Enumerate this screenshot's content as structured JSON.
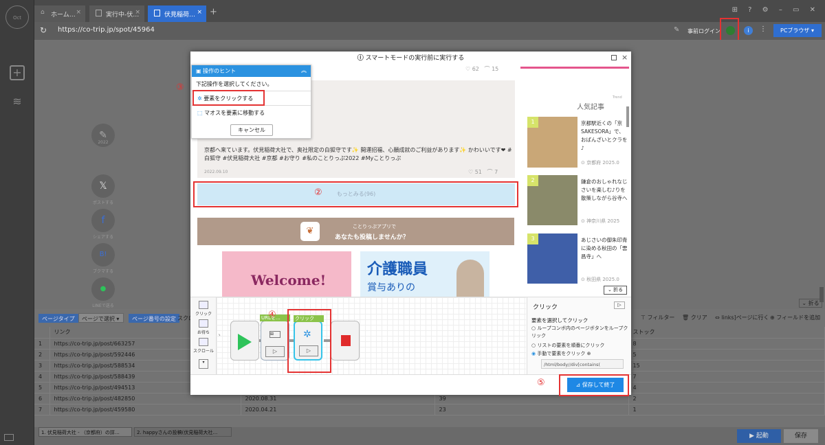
{
  "tabs": [
    {
      "label": "ホーム…"
    },
    {
      "label": "実行中-伏…"
    },
    {
      "label": "伏見稲荷…"
    }
  ],
  "url": "https://co-trip.jp/spot/45964",
  "toolbar": {
    "login": "事前ログイン",
    "browser": "PCブラウザ"
  },
  "page_actions": {
    "page_type": "ページタイプ",
    "page_select": "ページで選択",
    "page_number": "ページ番号の設定",
    "scroll": "スクロ",
    "filter": "フィルター",
    "clear": "クリア",
    "link_page": "links]ページに行く",
    "add_field": "フィールドを追加"
  },
  "table": {
    "col_link": "リンク",
    "col_stock": "ストック",
    "rows": [
      {
        "num": "1",
        "link": "https://co-trip.jp/post/663257",
        "date": "",
        "count": "",
        "stock": "8"
      },
      {
        "num": "2",
        "link": "https://co-trip.jp/post/592446",
        "date": "",
        "count": "",
        "stock": "5"
      },
      {
        "num": "3",
        "link": "https://co-trip.jp/post/588534",
        "date": "",
        "count": "",
        "stock": "15"
      },
      {
        "num": "4",
        "link": "https://co-trip.jp/post/588439",
        "date": "",
        "count": "",
        "stock": "7"
      },
      {
        "num": "5",
        "link": "https://co-trip.jp/post/494513",
        "date": "",
        "count": "",
        "stock": "4"
      },
      {
        "num": "6",
        "link": "https://co-trip.jp/post/482850",
        "date": "2020.08.31",
        "count": "39",
        "stock": "2"
      },
      {
        "num": "7",
        "link": "https://co-trip.jp/post/459580",
        "date": "2020.04.21",
        "count": "23",
        "stock": "1"
      }
    ]
  },
  "footer": {
    "tab1": "1. 伏見稲荷大社 - （京都府）の詳…",
    "tab2": "2. happyさんの投稿(伏見稲荷大社…",
    "run": "起動",
    "save": "保存"
  },
  "collapse": "折る",
  "modal": {
    "title": "スマートモードの実行前に実行する",
    "top_likes": "62",
    "top_clips": "15",
    "post_text": "京都へ来ています。伏見稲荷大社で、奥社限定の白狐守です✨ 開運招福、心願成就のご利益があります✨ かわいいです❤ #白狐守 #伏見稲荷大社 #京都 #お守り #私のことりっぷ2022 #Myことりっぷ",
    "post_date": "2022.09.10",
    "post_likes": "51",
    "post_clips": "7",
    "more_button": "もっとみる(96)",
    "app_banner_sub": "ことりっぷアプリで",
    "app_banner_main": "あなたも投稿しませんか？",
    "ad1": "Welcome!",
    "ad2": "介護職員",
    "ad2_sub": "賞与ありの",
    "popular_title": "人気記事",
    "trend": "Trend",
    "articles": [
      {
        "rank": "1",
        "text": "京都駅近くの「京SAKESORA」で、おばんざいとクラを♪",
        "pref": "京都府",
        "date": "2025.0"
      },
      {
        "rank": "2",
        "text": "鎌倉のおしゃれなじさいを楽しむ♪りを散策しながら谷寺へ",
        "pref": "神奈川県",
        "date": "2025"
      },
      {
        "rank": "3",
        "text": "あじさいの御朱印青に染める秋田の「雲昌寺」へ",
        "pref": "秋田県",
        "date": "2025.0"
      }
    ],
    "collapse": "折る",
    "hint": {
      "title": "操作のヒント",
      "prompt": "下記操作を選択してください。",
      "opt_click": "要素をクリックする",
      "opt_hover": "マオスを要素に移動する",
      "cancel": "キャンセル"
    },
    "tools": [
      "クリック",
      "お待ち",
      "スクロール"
    ],
    "nodes": [
      "URLを…",
      "クリック"
    ],
    "panel": {
      "title": "クリック",
      "subtitle": "要素を選択してクリック",
      "opt1": "ループコンボ内のページボタンをループクリック",
      "opt2": "リストの要素を順番にクリック",
      "opt3": "手動で要素をクリック",
      "xpath": "/html/body//div[contains("
    },
    "save_exit": "保存して終了"
  },
  "side_labels": [
    "ポストする",
    "シェアする",
    "ブクマする",
    "LINEで送る"
  ],
  "side_year": "2022",
  "annotations": [
    "①",
    "②",
    "③",
    "④",
    "⑤"
  ],
  "colors": {
    "accent": "#1e88e5",
    "red": "#e43232",
    "green": "#2ec35a",
    "stop": "#e02b2b",
    "tabActive": "#2f6ed0"
  }
}
